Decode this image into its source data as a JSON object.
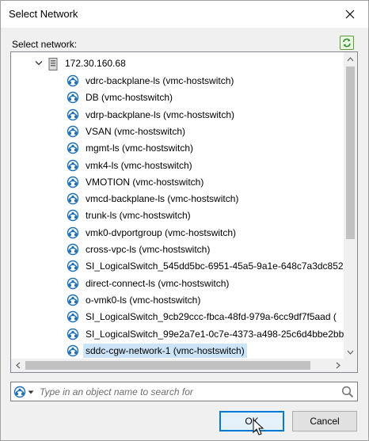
{
  "window": {
    "title": "Select Network"
  },
  "panel": {
    "label": "Select network:"
  },
  "tree": {
    "root": "172.30.160.68",
    "items": [
      {
        "label": "vdrc-backplane-ls (vmc-hostswitch)",
        "selected": false
      },
      {
        "label": "DB (vmc-hostswitch)",
        "selected": false
      },
      {
        "label": "vdrp-backplane-ls (vmc-hostswitch)",
        "selected": false
      },
      {
        "label": "VSAN (vmc-hostswitch)",
        "selected": false
      },
      {
        "label": "mgmt-ls (vmc-hostswitch)",
        "selected": false
      },
      {
        "label": "vmk4-ls (vmc-hostswitch)",
        "selected": false
      },
      {
        "label": "VMOTION (vmc-hostswitch)",
        "selected": false
      },
      {
        "label": "vmcd-backplane-ls (vmc-hostswitch)",
        "selected": false
      },
      {
        "label": "trunk-ls (vmc-hostswitch)",
        "selected": false
      },
      {
        "label": "vmk0-dvportgroup (vmc-hostswitch)",
        "selected": false
      },
      {
        "label": "cross-vpc-ls (vmc-hostswitch)",
        "selected": false
      },
      {
        "label": "SI_LogicalSwitch_545dd5bc-6951-45a5-9a1e-648c7a3dc852",
        "selected": false
      },
      {
        "label": "direct-connect-ls (vmc-hostswitch)",
        "selected": false
      },
      {
        "label": "o-vmk0-ls (vmc-hostswitch)",
        "selected": false
      },
      {
        "label": "SI_LogicalSwitch_9cb29ccc-fbca-48fd-979a-6cc9df7f5aad (",
        "selected": false
      },
      {
        "label": "SI_LogicalSwitch_99e2a7e1-0c7e-4373-a498-25c6d4bbe2bb",
        "selected": false
      },
      {
        "label": "sddc-cgw-network-1 (vmc-hostswitch)",
        "selected": true
      }
    ]
  },
  "search": {
    "placeholder": "Type in an object name to search for",
    "value": ""
  },
  "buttons": {
    "ok": "OK",
    "cancel": "Cancel"
  },
  "colors": {
    "selection": "#cce4f7",
    "focus": "#0078d7",
    "net_icon": "#1e6fb8"
  }
}
